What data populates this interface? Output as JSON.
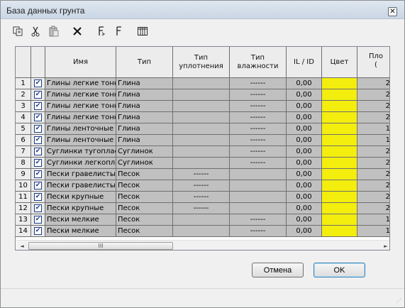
{
  "window": {
    "title": "База данных грунта",
    "close_glyph": "✕"
  },
  "toolbar": {
    "buttons": [
      {
        "name": "copy-icon"
      },
      {
        "name": "cut-icon"
      },
      {
        "name": "paste-icon"
      },
      {
        "name": "delete-icon"
      },
      {
        "name": "insert-row-icon"
      },
      {
        "name": "add-row-icon"
      },
      {
        "name": "columns-icon"
      }
    ]
  },
  "table": {
    "headers": {
      "name": "Имя",
      "type": "Тип",
      "compaction": "Тип уплотнения",
      "moisture": "Тип влажности",
      "ilid": "IL / ID",
      "color": "Цвет",
      "plot": "Пло (",
      "plot_line2": "(",
      "plot_line1": "Пло"
    },
    "rows": [
      {
        "num": "1",
        "checked": "✔",
        "name": "Глины легкие тонк",
        "type": "Глина",
        "compaction": "",
        "moisture": "------",
        "ilid": "0,00",
        "plot": "2"
      },
      {
        "num": "2",
        "checked": "✔",
        "name": "Глины легкие тонк",
        "type": "Глина",
        "compaction": "",
        "moisture": "------",
        "ilid": "0,00",
        "plot": "2"
      },
      {
        "num": "3",
        "checked": "✔",
        "name": "Глины легкие тонк",
        "type": "Глина",
        "compaction": "",
        "moisture": "------",
        "ilid": "0,00",
        "plot": "2"
      },
      {
        "num": "4",
        "checked": "✔",
        "name": "Глины легкие тонк",
        "type": "Глина",
        "compaction": "",
        "moisture": "------",
        "ilid": "0,00",
        "plot": "2"
      },
      {
        "num": "5",
        "checked": "✔",
        "name": "Глины ленточные",
        "type": "Глина",
        "compaction": "",
        "moisture": "------",
        "ilid": "0,00",
        "plot": "1"
      },
      {
        "num": "6",
        "checked": "✔",
        "name": "Глины ленточные",
        "type": "Глина",
        "compaction": "",
        "moisture": "------",
        "ilid": "0,00",
        "plot": "1"
      },
      {
        "num": "7",
        "checked": "✔",
        "name": "Суглинки тугоплас",
        "type": "Суглинок",
        "compaction": "",
        "moisture": "------",
        "ilid": "0,00",
        "plot": "2"
      },
      {
        "num": "8",
        "checked": "✔",
        "name": "Суглинки легкопла",
        "type": "Суглинок",
        "compaction": "",
        "moisture": "------",
        "ilid": "0,00",
        "plot": "2"
      },
      {
        "num": "9",
        "checked": "✔",
        "name": "Пески гравелисты",
        "type": "Песок",
        "compaction": "------",
        "moisture": "",
        "ilid": "0,00",
        "plot": "2"
      },
      {
        "num": "10",
        "checked": "✔",
        "name": "Пески гравелисты",
        "type": "Песок",
        "compaction": "------",
        "moisture": "",
        "ilid": "0,00",
        "plot": "2"
      },
      {
        "num": "11",
        "checked": "✔",
        "name": "Пески крупные",
        "type": "Песок",
        "compaction": "------",
        "moisture": "",
        "ilid": "0,00",
        "plot": "2"
      },
      {
        "num": "12",
        "checked": "✔",
        "name": "Пески крупные",
        "type": "Песок",
        "compaction": "------",
        "moisture": "",
        "ilid": "0,00",
        "plot": "2"
      },
      {
        "num": "13",
        "checked": "✔",
        "name": "Пески мелкие",
        "type": "Песок",
        "compaction": "",
        "moisture": "------",
        "ilid": "0,00",
        "plot": "1"
      },
      {
        "num": "14",
        "checked": "✔",
        "name": "Пески мелкие",
        "type": "Песок",
        "compaction": "",
        "moisture": "------",
        "ilid": "0,00",
        "plot": "1"
      }
    ],
    "color_value": "#f4ee0e"
  },
  "scroll": {
    "up": "▲",
    "down": "▼",
    "left": "◄",
    "right": "►",
    "thumb_grip": "III"
  },
  "buttons": {
    "cancel": "Отмена",
    "ok": "OK"
  },
  "statusbar": {
    "grip": "⋰"
  }
}
